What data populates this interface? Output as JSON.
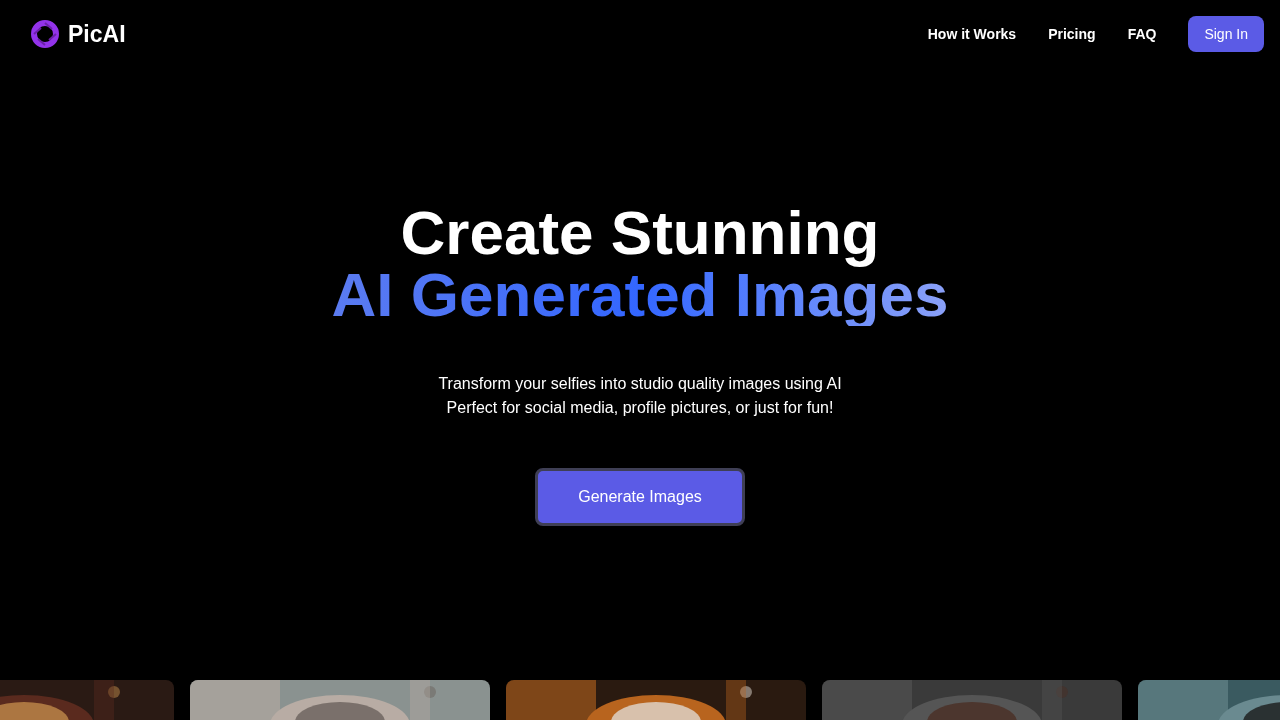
{
  "header": {
    "logo": "PicAI",
    "nav": [
      {
        "label": "How it Works"
      },
      {
        "label": "Pricing"
      },
      {
        "label": "FAQ"
      }
    ],
    "sign_in": "Sign In"
  },
  "hero": {
    "title_line_1": "Create Stunning",
    "title_line_2": "AI Generated Images",
    "subtitle_lines": [
      "Transform your selfies into studio quality images using AI",
      "Perfect for social media, profile pictures, or just for fun!"
    ],
    "cta": "Generate Images"
  }
}
